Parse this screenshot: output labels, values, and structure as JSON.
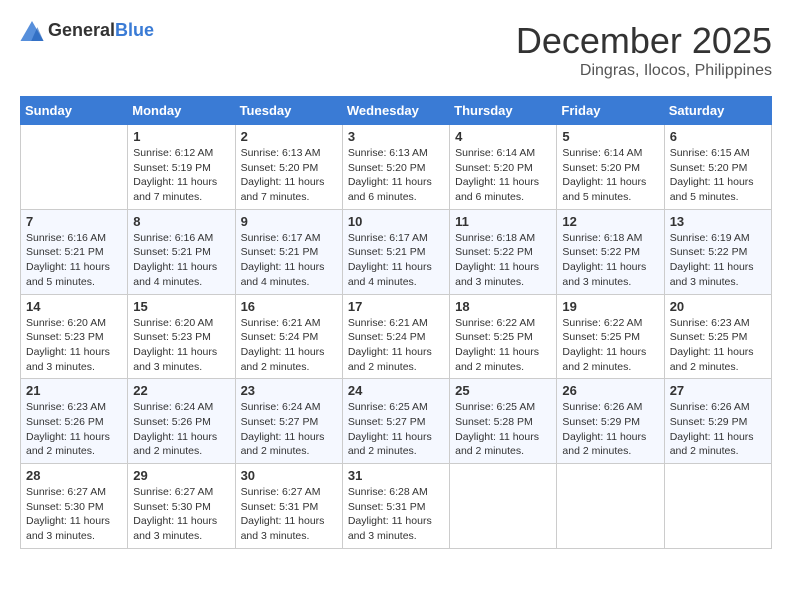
{
  "header": {
    "logo_general": "General",
    "logo_blue": "Blue",
    "month": "December 2025",
    "location": "Dingras, Ilocos, Philippines"
  },
  "days_of_week": [
    "Sunday",
    "Monday",
    "Tuesday",
    "Wednesday",
    "Thursday",
    "Friday",
    "Saturday"
  ],
  "weeks": [
    [
      {
        "day": "",
        "info": ""
      },
      {
        "day": "1",
        "info": "Sunrise: 6:12 AM\nSunset: 5:19 PM\nDaylight: 11 hours\nand 7 minutes."
      },
      {
        "day": "2",
        "info": "Sunrise: 6:13 AM\nSunset: 5:20 PM\nDaylight: 11 hours\nand 7 minutes."
      },
      {
        "day": "3",
        "info": "Sunrise: 6:13 AM\nSunset: 5:20 PM\nDaylight: 11 hours\nand 6 minutes."
      },
      {
        "day": "4",
        "info": "Sunrise: 6:14 AM\nSunset: 5:20 PM\nDaylight: 11 hours\nand 6 minutes."
      },
      {
        "day": "5",
        "info": "Sunrise: 6:14 AM\nSunset: 5:20 PM\nDaylight: 11 hours\nand 5 minutes."
      },
      {
        "day": "6",
        "info": "Sunrise: 6:15 AM\nSunset: 5:20 PM\nDaylight: 11 hours\nand 5 minutes."
      }
    ],
    [
      {
        "day": "7",
        "info": "Sunrise: 6:16 AM\nSunset: 5:21 PM\nDaylight: 11 hours\nand 5 minutes."
      },
      {
        "day": "8",
        "info": "Sunrise: 6:16 AM\nSunset: 5:21 PM\nDaylight: 11 hours\nand 4 minutes."
      },
      {
        "day": "9",
        "info": "Sunrise: 6:17 AM\nSunset: 5:21 PM\nDaylight: 11 hours\nand 4 minutes."
      },
      {
        "day": "10",
        "info": "Sunrise: 6:17 AM\nSunset: 5:21 PM\nDaylight: 11 hours\nand 4 minutes."
      },
      {
        "day": "11",
        "info": "Sunrise: 6:18 AM\nSunset: 5:22 PM\nDaylight: 11 hours\nand 3 minutes."
      },
      {
        "day": "12",
        "info": "Sunrise: 6:18 AM\nSunset: 5:22 PM\nDaylight: 11 hours\nand 3 minutes."
      },
      {
        "day": "13",
        "info": "Sunrise: 6:19 AM\nSunset: 5:22 PM\nDaylight: 11 hours\nand 3 minutes."
      }
    ],
    [
      {
        "day": "14",
        "info": "Sunrise: 6:20 AM\nSunset: 5:23 PM\nDaylight: 11 hours\nand 3 minutes."
      },
      {
        "day": "15",
        "info": "Sunrise: 6:20 AM\nSunset: 5:23 PM\nDaylight: 11 hours\nand 3 minutes."
      },
      {
        "day": "16",
        "info": "Sunrise: 6:21 AM\nSunset: 5:24 PM\nDaylight: 11 hours\nand 2 minutes."
      },
      {
        "day": "17",
        "info": "Sunrise: 6:21 AM\nSunset: 5:24 PM\nDaylight: 11 hours\nand 2 minutes."
      },
      {
        "day": "18",
        "info": "Sunrise: 6:22 AM\nSunset: 5:25 PM\nDaylight: 11 hours\nand 2 minutes."
      },
      {
        "day": "19",
        "info": "Sunrise: 6:22 AM\nSunset: 5:25 PM\nDaylight: 11 hours\nand 2 minutes."
      },
      {
        "day": "20",
        "info": "Sunrise: 6:23 AM\nSunset: 5:25 PM\nDaylight: 11 hours\nand 2 minutes."
      }
    ],
    [
      {
        "day": "21",
        "info": "Sunrise: 6:23 AM\nSunset: 5:26 PM\nDaylight: 11 hours\nand 2 minutes."
      },
      {
        "day": "22",
        "info": "Sunrise: 6:24 AM\nSunset: 5:26 PM\nDaylight: 11 hours\nand 2 minutes."
      },
      {
        "day": "23",
        "info": "Sunrise: 6:24 AM\nSunset: 5:27 PM\nDaylight: 11 hours\nand 2 minutes."
      },
      {
        "day": "24",
        "info": "Sunrise: 6:25 AM\nSunset: 5:27 PM\nDaylight: 11 hours\nand 2 minutes."
      },
      {
        "day": "25",
        "info": "Sunrise: 6:25 AM\nSunset: 5:28 PM\nDaylight: 11 hours\nand 2 minutes."
      },
      {
        "day": "26",
        "info": "Sunrise: 6:26 AM\nSunset: 5:29 PM\nDaylight: 11 hours\nand 2 minutes."
      },
      {
        "day": "27",
        "info": "Sunrise: 6:26 AM\nSunset: 5:29 PM\nDaylight: 11 hours\nand 2 minutes."
      }
    ],
    [
      {
        "day": "28",
        "info": "Sunrise: 6:27 AM\nSunset: 5:30 PM\nDaylight: 11 hours\nand 3 minutes."
      },
      {
        "day": "29",
        "info": "Sunrise: 6:27 AM\nSunset: 5:30 PM\nDaylight: 11 hours\nand 3 minutes."
      },
      {
        "day": "30",
        "info": "Sunrise: 6:27 AM\nSunset: 5:31 PM\nDaylight: 11 hours\nand 3 minutes."
      },
      {
        "day": "31",
        "info": "Sunrise: 6:28 AM\nSunset: 5:31 PM\nDaylight: 11 hours\nand 3 minutes."
      },
      {
        "day": "",
        "info": ""
      },
      {
        "day": "",
        "info": ""
      },
      {
        "day": "",
        "info": ""
      }
    ]
  ]
}
